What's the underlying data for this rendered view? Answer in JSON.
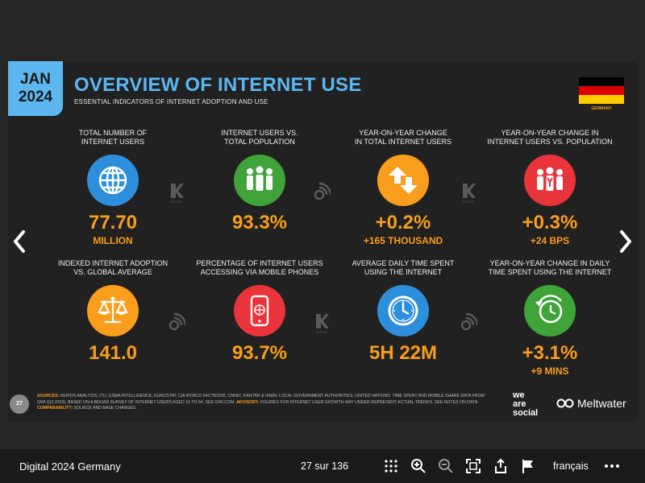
{
  "slide": {
    "date_month": "JAN",
    "date_year": "2024",
    "title": "OVERVIEW OF INTERNET USE",
    "subtitle": "ESSENTIAL INDICATORS OF INTERNET ADOPTION AND USE",
    "country": "GERMANY",
    "page_number": "27",
    "colors": {
      "accent_blue": "#5cb6f0",
      "orange": "#f99d1c",
      "red": "#e8343a",
      "green": "#3fa33a"
    },
    "metrics": [
      {
        "label": "TOTAL NUMBER OF\nINTERNET USERS",
        "icon": "globe-icon",
        "color": "#2d8fdb",
        "value": "77.70",
        "sub": "MILLION"
      },
      {
        "label": "INTERNET USERS vs.\nTOTAL POPULATION",
        "icon": "people-icon",
        "color": "#3fa33a",
        "value": "93.3%",
        "sub": ""
      },
      {
        "label": "YEAR-ON-YEAR CHANGE\nIN TOTAL INTERNET USERS",
        "icon": "updown-arrows-icon",
        "color": "#f99d1c",
        "value": "+0.2%",
        "sub": "+165 THOUSAND"
      },
      {
        "label": "YEAR-ON-YEAR CHANGE IN\nINTERNET USERS vs. POPULATION",
        "icon": "people-change-icon",
        "color": "#e8343a",
        "value": "+0.3%",
        "sub": "+24 BPS"
      },
      {
        "label": "INDEXED INTERNET ADOPTION\nvs. GLOBAL AVERAGE",
        "icon": "scales-icon",
        "color": "#f99d1c",
        "value": "141.0",
        "sub": ""
      },
      {
        "label": "PERCENTAGE OF INTERNET USERS\nACCESSING VIA MOBILE PHONES",
        "icon": "mobile-phone-icon",
        "color": "#e8343a",
        "value": "93.7%",
        "sub": ""
      },
      {
        "label": "AVERAGE DAILY TIME SPENT\nUSING THE INTERNET",
        "icon": "clock-icon",
        "color": "#2d8fdb",
        "value": "5H 22M",
        "sub": ""
      },
      {
        "label": "YEAR-ON-YEAR CHANGE IN DAILY\nTIME SPENT USING THE INTERNET",
        "icon": "clock-change-icon",
        "color": "#3fa33a",
        "value": "+3.1%",
        "sub": "+9 MINS"
      }
    ],
    "sources_label": "SOURCES:",
    "sources_text": "KEPIOS ANALYSIS; ITU; GSMA INTELLIGENCE; EUROSTAT; CIA WORLD FACTBOOK; CNNIC; KANTAR & IAMAI; LOCAL GOVERNMENT AUTHORITIES; UNITED NATIONS. TIME SPENT AND MOBILE SHARE DATA FROM GWI (Q3 2023), BASED ON A BROAD SURVEY OF INTERNET USERS AGED 16 TO 64. SEE GWI.COM.",
    "advisory_label": "ADVISORY:",
    "advisory_text": "FIGURES FOR INTERNET USER GROWTH MAY UNDER-REPRESENT ACTUAL TRENDS. SEE NOTES ON DATA.",
    "comparability_label": "COMPARABILITY:",
    "comparability_text": "SOURCE AND BASE CHANGES.",
    "brand_1_line1": "we",
    "brand_1_line2": "are",
    "brand_1_line3": "social",
    "brand_2": "Meltwater",
    "kepios_label": "KEPIOS"
  },
  "viewer": {
    "doc_title": "Digital 2024 Germany",
    "page_indicator": "27 sur 136",
    "language": "français",
    "tools": [
      "grid-icon",
      "zoom-in-icon",
      "zoom-out-icon",
      "fullscreen-icon",
      "share-icon",
      "flag-icon",
      "more-icon"
    ]
  }
}
